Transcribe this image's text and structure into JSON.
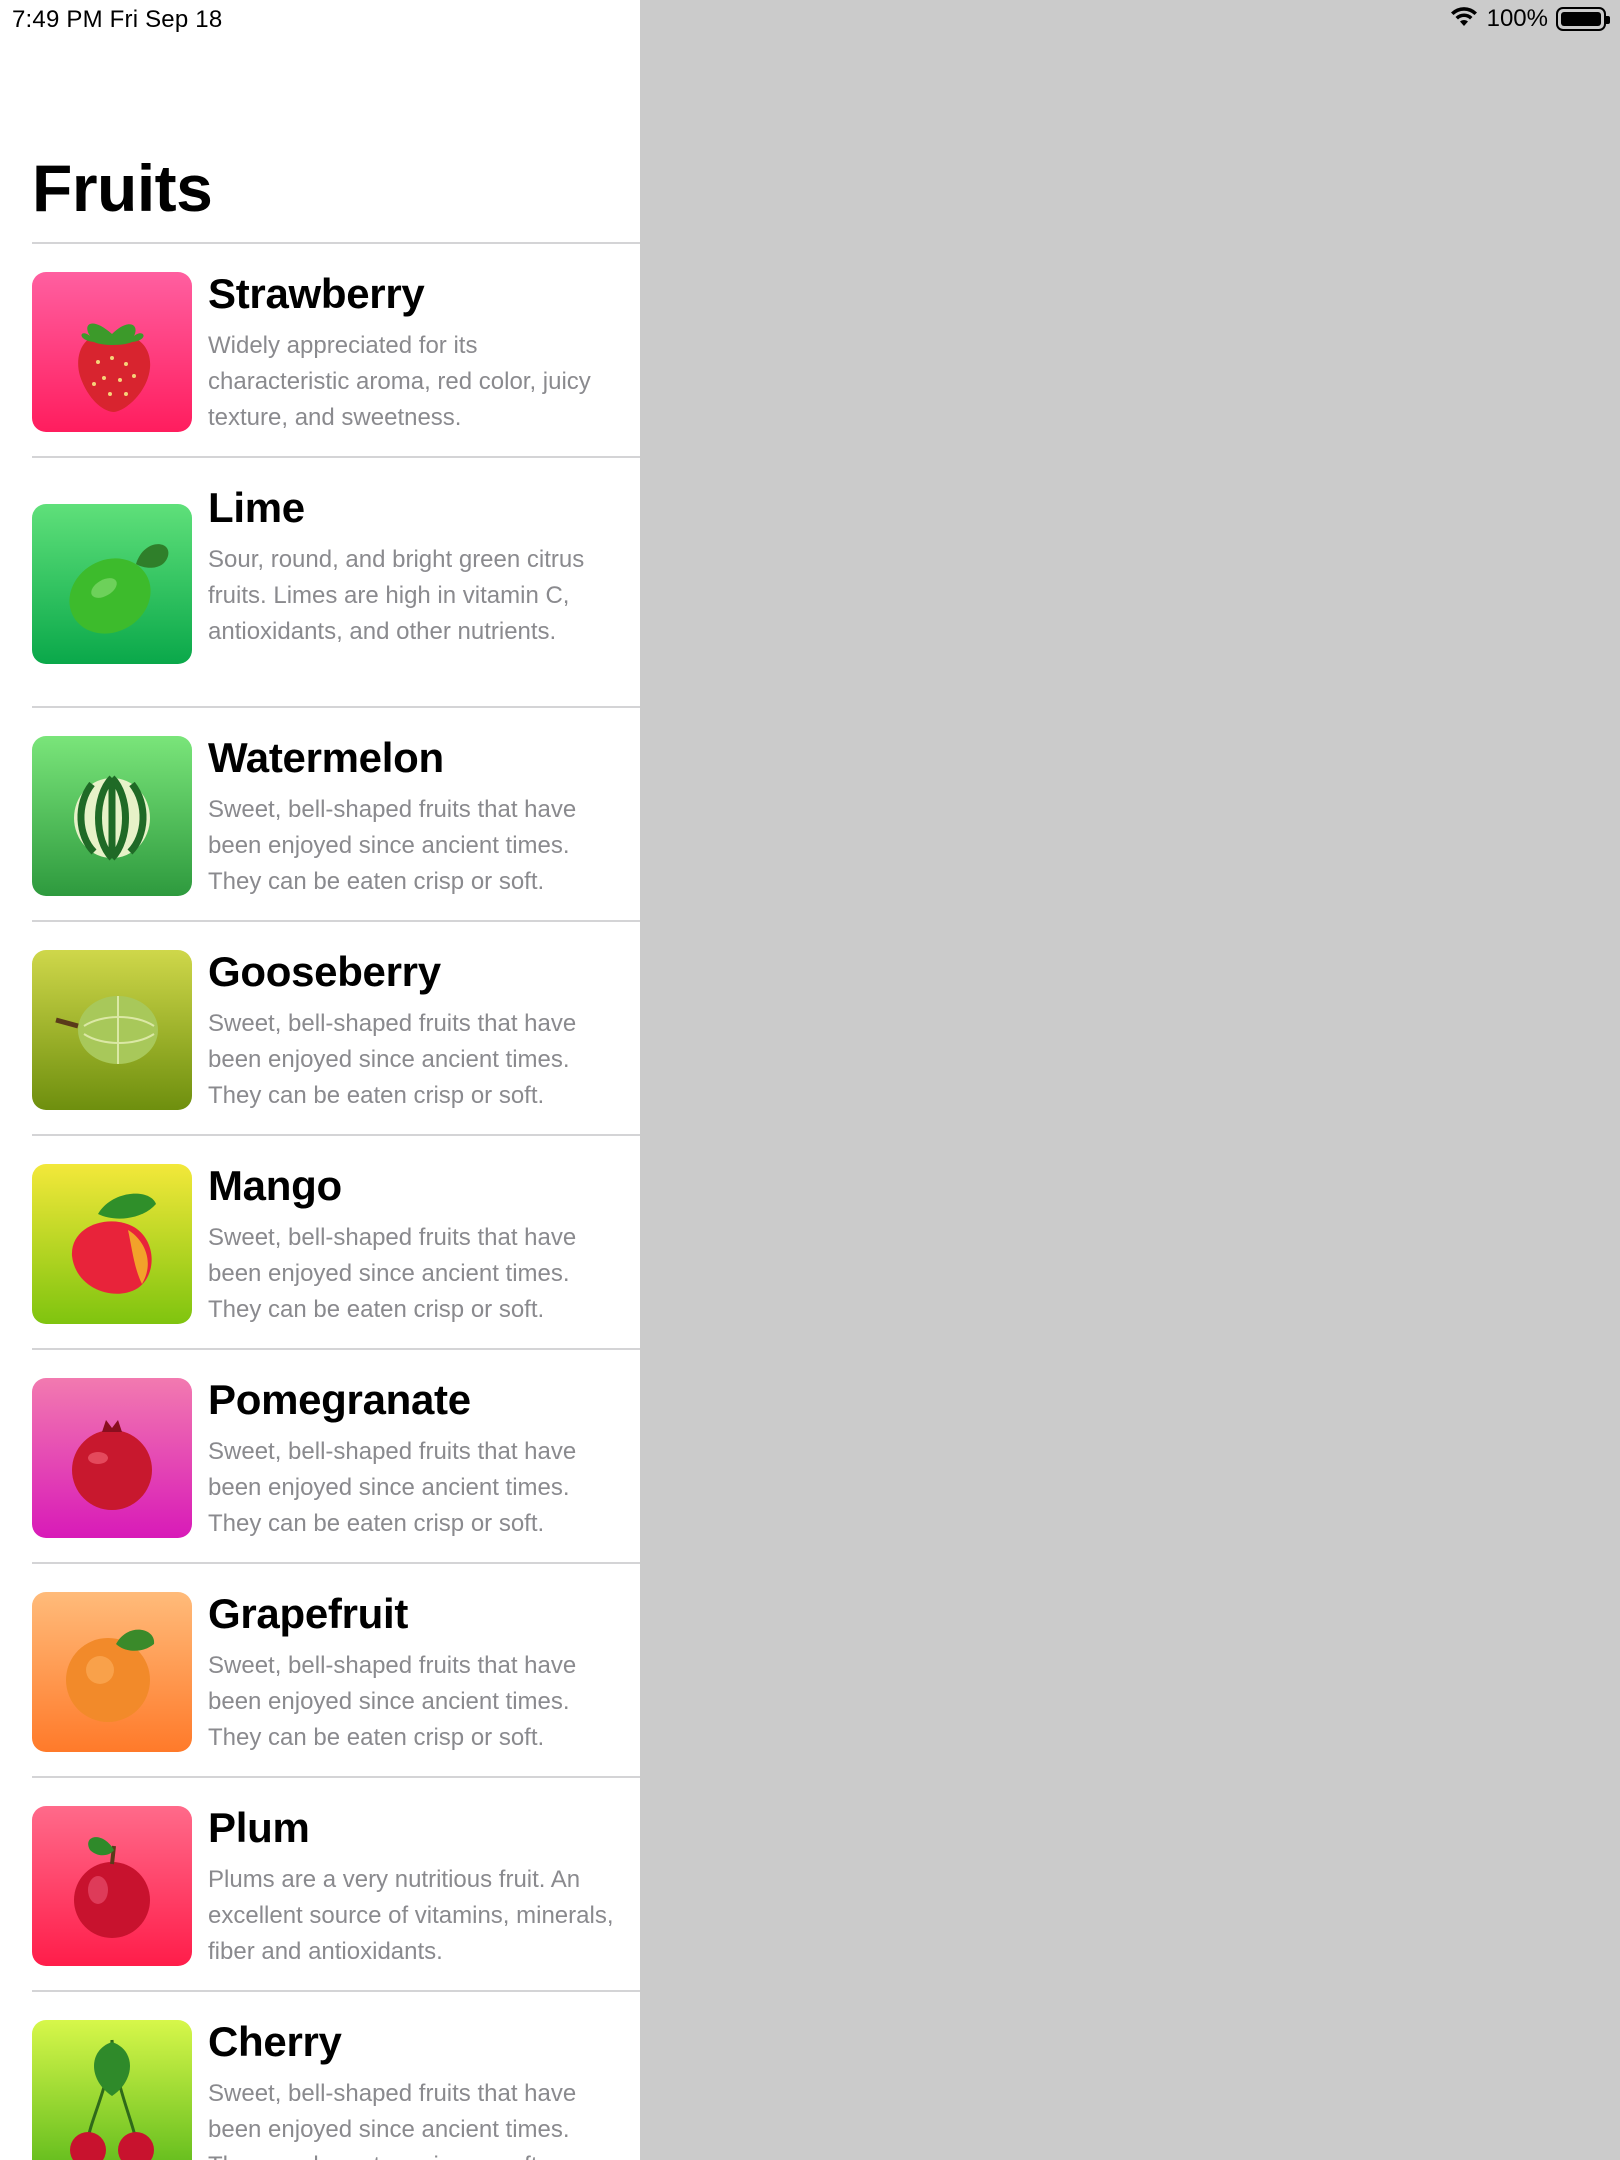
{
  "status_bar": {
    "time": "7:49 PM   Fri Sep 18",
    "battery": "100%",
    "icons": [
      "wifi-icon",
      "battery-icon"
    ]
  },
  "sidebar": {
    "title": "Fruits",
    "items": [
      {
        "name": "Strawberry",
        "description": "Widely appreciated for its characteristic aroma,  red color, juicy texture, and sweetness.",
        "icon": "strawberry-image",
        "gradient": [
          "#ff5fa0",
          "#ff1d5e"
        ]
      },
      {
        "name": "Lime",
        "description": "Sour, round, and bright green citrus fruits. Limes are high in vitamin C, antioxidants, and other nutrients.",
        "icon": "lime-image",
        "gradient": [
          "#5fe07a",
          "#0aa84a"
        ]
      },
      {
        "name": "Watermelon",
        "description": "Sweet, bell-shaped fruits that have been enjoyed since ancient times. They can be eaten crisp or soft.",
        "icon": "watermelon-image",
        "gradient": [
          "#7ae57a",
          "#2e9a3e"
        ]
      },
      {
        "name": "Gooseberry",
        "description": "Sweet, bell-shaped fruits that have been enjoyed since ancient times. They can be eaten crisp or soft.",
        "icon": "gooseberry-image",
        "gradient": [
          "#cfd74a",
          "#6e8f0e"
        ]
      },
      {
        "name": "Mango",
        "description": "Sweet, bell-shaped fruits that have been enjoyed since ancient times. They can be eaten crisp or soft.",
        "icon": "mango-image",
        "gradient": [
          "#f3e83a",
          "#7fc40f"
        ]
      },
      {
        "name": "Pomegranate",
        "description": "Sweet, bell-shaped fruits that have been enjoyed since ancient times. They can be eaten crisp or soft.",
        "icon": "pomegranate-image",
        "gradient": [
          "#f27ab0",
          "#d81ab8"
        ]
      },
      {
        "name": "Grapefruit",
        "description": "Sweet, bell-shaped fruits that have been enjoyed since ancient times. They can be eaten crisp or soft.",
        "icon": "grapefruit-image",
        "gradient": [
          "#ffbb7a",
          "#ff7a2a"
        ]
      },
      {
        "name": "Plum",
        "description": "Plums are a very nutritious fruit. An excellent source of vitamins, minerals, fiber and antioxidants.",
        "icon": "plum-image",
        "gradient": [
          "#ff6a8a",
          "#ff1d4a"
        ]
      },
      {
        "name": "Cherry",
        "description": "Sweet, bell-shaped fruits that have been enjoyed since ancient times. They can be eaten crisp or soft.",
        "icon": "cherry-image",
        "gradient": [
          "#d7f74a",
          "#5ab81a"
        ]
      }
    ]
  },
  "colors": {
    "detail_background": "#cbcbcb",
    "sidebar_background": "#ffffff",
    "title_text": "#000000",
    "description_text": "#8a8a8e",
    "separator": "#d4d4d6"
  }
}
